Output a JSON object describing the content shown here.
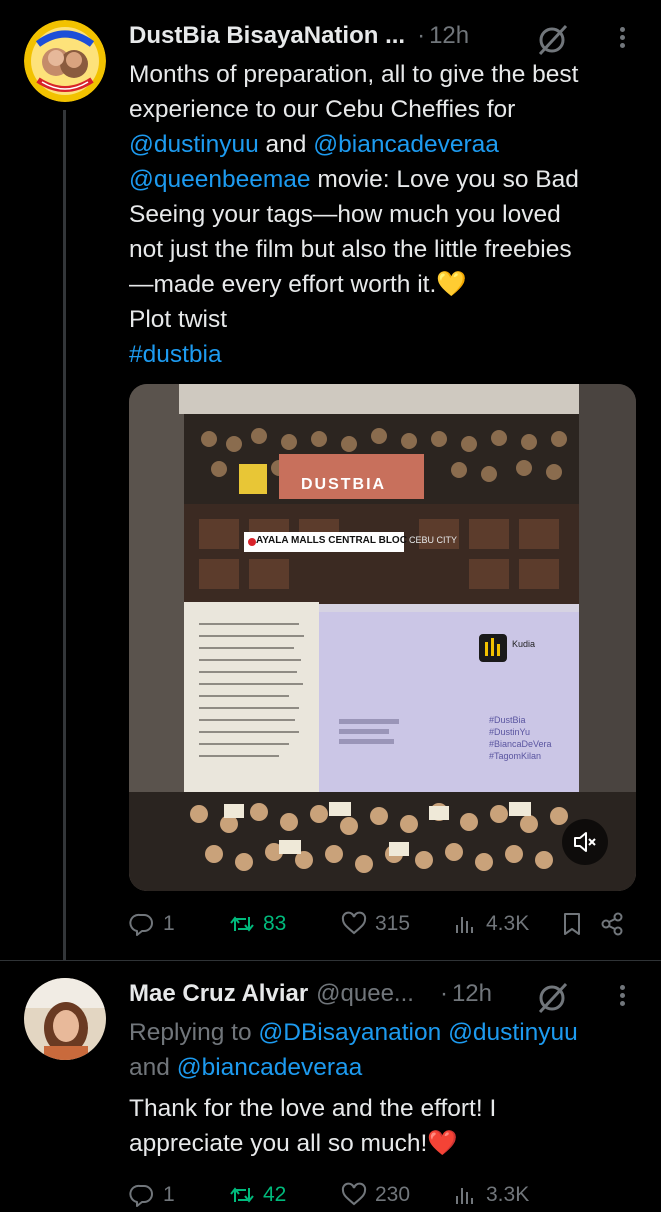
{
  "tweet1": {
    "display_name": "DustBia BisayaNation ...",
    "time": "12h",
    "text_lines": [
      {
        "t": "Months of preparation, all to give the best"
      },
      {
        "t": "experience to our Cebu Cheffies for"
      },
      {
        "parts": [
          {
            "t": "@dustinyuu",
            "link": true
          },
          {
            "t": " and "
          },
          {
            "t": "@biancadeveraa",
            "link": true
          }
        ]
      },
      {
        "parts": [
          {
            "t": "@queenbeemae",
            "link": true
          },
          {
            "t": " movie: Love you so Bad"
          }
        ]
      },
      {
        "t": "Seeing your tags—how much you loved"
      },
      {
        "t": "not just the film but also the little freebies"
      },
      {
        "t": "—made every effort worth it.💛"
      },
      {
        "t": "Plot twist"
      },
      {
        "parts": [
          {
            "t": "#dustbia",
            "link": true
          }
        ]
      }
    ],
    "media": {
      "banner_text": "DUSTBIA",
      "location_text": "AYALA MALLS CENTRAL BLOC",
      "location_suffix": "CEBU CITY",
      "app_label": "Kudia",
      "hashtags": [
        "#DustBia",
        "#DustinYu",
        "#BiancaDeVera",
        "#TagomKilan"
      ]
    },
    "actions": {
      "replies": "1",
      "reposts": "83",
      "likes": "315",
      "views": "4.3K"
    }
  },
  "tweet2": {
    "display_name": "Mae Cruz Alviar",
    "handle": "@quee...",
    "time": "12h",
    "replying_prefix": "Replying to",
    "replying_to": [
      "@DBisayanation",
      "@dustinyuu",
      "@biancadeveraa"
    ],
    "replying_and": "and",
    "text_lines": [
      "Thank for the love and the effort! I",
      "appreciate you all so much!❤️"
    ],
    "actions": {
      "replies": "1",
      "reposts": "42",
      "likes": "230",
      "views": "3.3K"
    }
  },
  "colors": {
    "background": "#000000",
    "text": "#e7e9ea",
    "secondary": "#71767b",
    "link": "#1d9bf0",
    "repost": "#00ba7c"
  }
}
